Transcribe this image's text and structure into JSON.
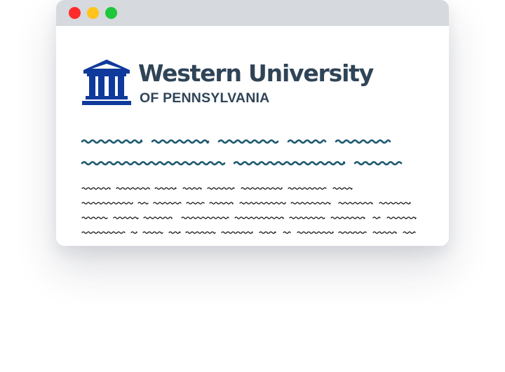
{
  "window": {
    "controls": [
      "close",
      "minimize",
      "maximize"
    ]
  },
  "brand": {
    "name": "Western University",
    "subtitle": "OF PENNSYLVANIA",
    "logo_icon": "university-building-icon",
    "colors": {
      "logo_blue": "#0f3a9c",
      "text": "#2f4457",
      "heading_scribble": "#1d5a70",
      "body_scribble": "#111111"
    }
  }
}
